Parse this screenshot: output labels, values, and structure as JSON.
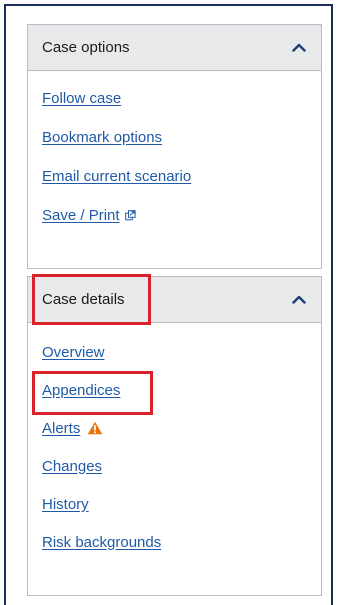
{
  "case_options": {
    "title": "Case options",
    "links": [
      {
        "label": "Follow case"
      },
      {
        "label": "Bookmark options"
      },
      {
        "label": "Email current scenario"
      },
      {
        "label": "Save / Print"
      }
    ]
  },
  "case_details": {
    "title": "Case details",
    "links": [
      {
        "label": "Overview"
      },
      {
        "label": "Appendices"
      },
      {
        "label": "Alerts"
      },
      {
        "label": "Changes"
      },
      {
        "label": "History"
      },
      {
        "label": "Risk backgrounds"
      }
    ]
  },
  "colors": {
    "link": "#1f5aa8",
    "header_bg": "#e7e9eb",
    "highlight": "#d9232c",
    "warning": "#e8740c",
    "chevron": "#1c3f73"
  }
}
